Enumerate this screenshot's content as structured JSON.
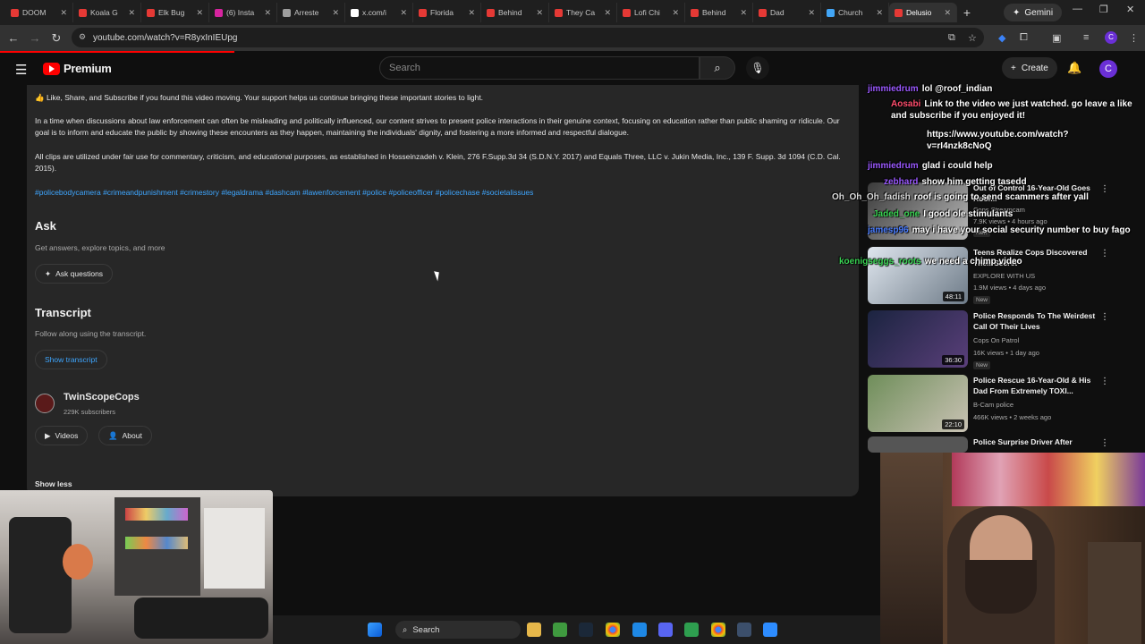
{
  "browser": {
    "tabs": [
      {
        "label": "DOOM",
        "color": "#e53935"
      },
      {
        "label": "Koala G",
        "color": "#e53935"
      },
      {
        "label": "Elk Bug",
        "color": "#e53935"
      },
      {
        "label": "(6) Insta",
        "color": "#d6249f"
      },
      {
        "label": "Arreste",
        "color": "#9e9e9e"
      },
      {
        "label": "x.com/i",
        "color": "#ffffff"
      },
      {
        "label": "Florida",
        "color": "#e53935"
      },
      {
        "label": "Behind",
        "color": "#e53935"
      },
      {
        "label": "They Ca",
        "color": "#e53935"
      },
      {
        "label": "Lofi Chi",
        "color": "#e53935"
      },
      {
        "label": "Behind",
        "color": "#e53935"
      },
      {
        "label": "Dad",
        "color": "#e53935"
      },
      {
        "label": "Church",
        "color": "#42a5f5"
      },
      {
        "label": "Delusio",
        "color": "#e53935"
      }
    ],
    "gemini_label": "Gemini",
    "url": "youtube.com/watch?v=R8yxInIEUpg"
  },
  "masthead": {
    "logo_text": "Premium",
    "search_placeholder": "Search",
    "create_label": "Create",
    "avatar_letter": "C"
  },
  "description": {
    "line1": "👍 Like, Share, and Subscribe if you found this video moving. Your support helps us continue bringing these important stories to light.",
    "paragraph2": "In a time when discussions about law enforcement can often be misleading and politically influenced, our content strives to present police interactions in their genuine context, focusing on education rather than public shaming or ridicule. Our goal is to inform and educate the public by showing these encounters as they happen, maintaining the individuals' dignity, and fostering a more informed and respectful dialogue.",
    "paragraph3": "All clips are utilized under fair use for commentary, criticism, and educational purposes, as established in Hosseinzadeh v. Klein, 276 F.Supp.3d 34 (S.D.N.Y. 2017) and Equals Three, LLC v. Jukin Media, Inc., 139 F. Supp. 3d 1094 (C.D. Cal. 2015).",
    "hashtags": "#policebodycamera #crimeandpunishment #crimestory #legaldrama #dashcam #lawenforcement #police #policeofficer #policechase #societalissues",
    "ask_title": "Ask",
    "ask_sub": "Get answers, explore topics, and more",
    "ask_button": "Ask questions",
    "transcript_title": "Transcript",
    "transcript_sub": "Follow along using the transcript.",
    "transcript_button": "Show transcript",
    "channel_name": "TwinScopeCops",
    "channel_subs": "229K subscribers",
    "videos_button": "Videos",
    "about_button": "About",
    "show_less": "Show less"
  },
  "sidebar_videos": [
    {
      "title": "Out of Control 16-Year-Old Goes Roof...",
      "channel": "Cops Streamcam",
      "meta": "7.9K views • 4 hours ago",
      "duration": "",
      "new": "New"
    },
    {
      "title": "Teens Realize Cops Discovered Their Secret",
      "channel": "EXPLORE WITH US",
      "meta": "1.9M views • 4 days ago",
      "duration": "48:11",
      "new": "New"
    },
    {
      "title": "Police Responds To The Weirdest Call Of Their Lives",
      "channel": "Cops On Patrol",
      "meta": "16K views • 1 day ago",
      "duration": "36:30",
      "new": "New"
    },
    {
      "title": "Police Rescue 16-Year-Old & His Dad From Extremely TOXI...",
      "channel": "B-Cam police",
      "meta": "466K views • 2 weeks ago",
      "duration": "22:10",
      "new": ""
    },
    {
      "title": "Police Surprise Driver After",
      "channel": "",
      "meta": "",
      "duration": "",
      "new": ""
    }
  ],
  "chat": [
    {
      "user": "jimmiedrum",
      "msg": "lol @roof_indian",
      "color": "#9b59ff"
    },
    {
      "user": "Aosabi",
      "msg": "Link to the video we just watched. go leave a like and subscribe if you enjoyed it!",
      "color": "#ff4d6d"
    },
    {
      "user": "",
      "msg": "https://www.youtube.com/watch?v=rI4nzk8cNoQ",
      "color": "#ffffff"
    },
    {
      "user": "jimmiedrum",
      "msg": "glad i could help",
      "color": "#9b59ff"
    },
    {
      "user": "zebhard",
      "msg": "show him getting tasedd",
      "color": "#9b59ff"
    },
    {
      "user": "Oh_Oh_Oh_fadish",
      "msg": "roof is going to send scammers after yall",
      "color": "#dddddd"
    },
    {
      "user": "Jaded_one",
      "msg": "I good ole stimulants",
      "color": "#39d353"
    },
    {
      "user": "jamesp96",
      "msg": "may i have your social security number to buy fago",
      "color": "#4a7dff"
    },
    {
      "user": "koenigseggs_roots",
      "msg": "we need a chimp video",
      "color": "#39d353"
    }
  ],
  "taskbar": {
    "search_label": "Search"
  },
  "colors": {
    "yt_red": "#ff0000",
    "link_blue": "#3ea6ff",
    "panel": "#272727"
  }
}
